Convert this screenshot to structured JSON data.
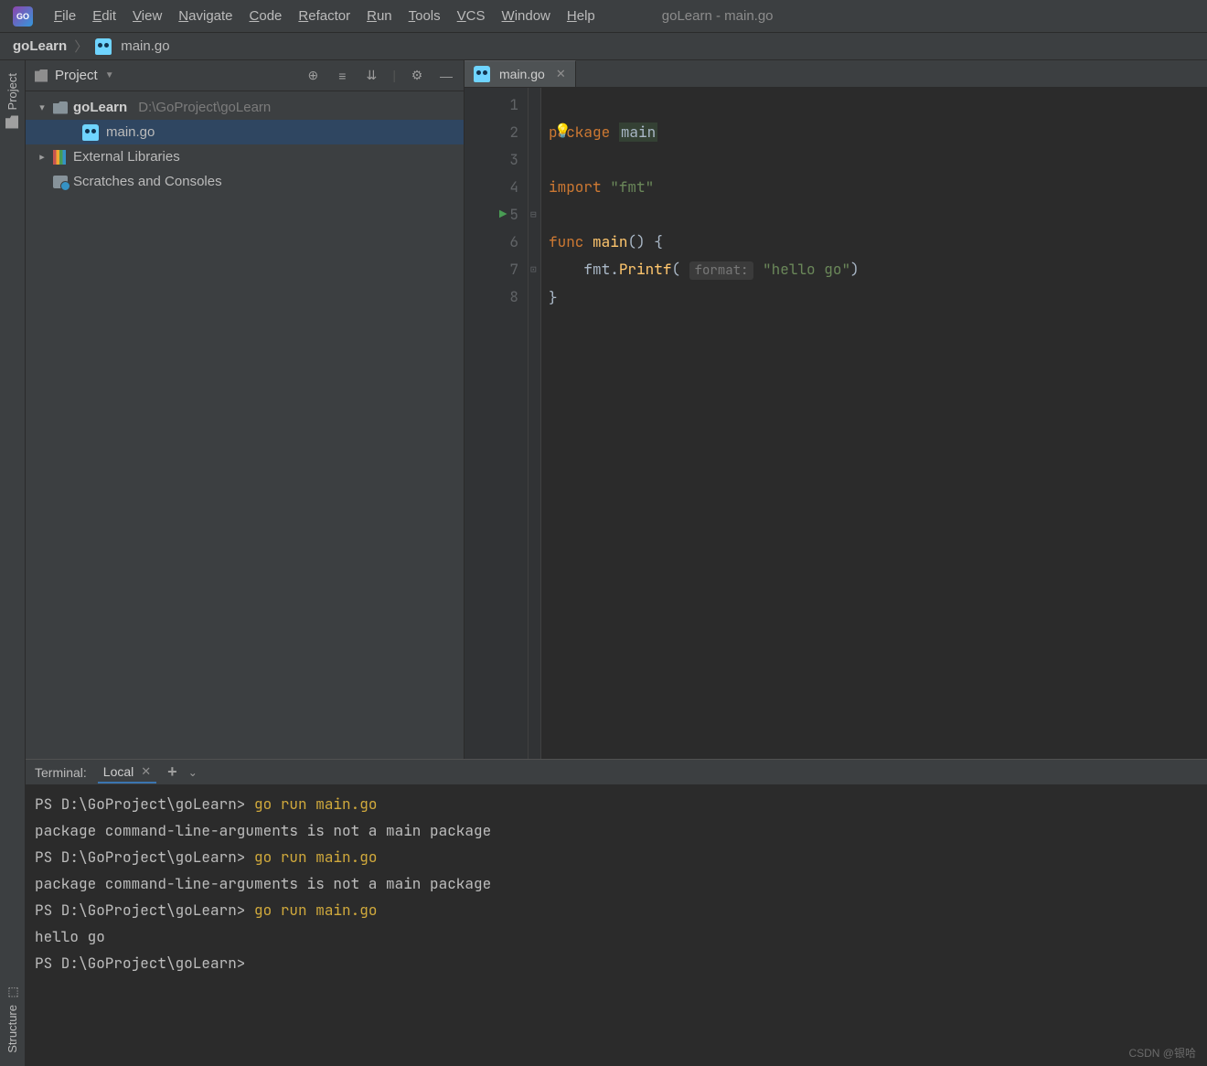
{
  "window_title": "goLearn - main.go",
  "menu": [
    "File",
    "Edit",
    "View",
    "Navigate",
    "Code",
    "Refactor",
    "Run",
    "Tools",
    "VCS",
    "Window",
    "Help"
  ],
  "breadcrumb": {
    "project": "goLearn",
    "file": "main.go"
  },
  "left_tabs": {
    "top": "Project",
    "bottom": "Structure"
  },
  "project_panel": {
    "title": "Project",
    "root": "goLearn",
    "root_path": "D:\\GoProject\\goLearn",
    "file": "main.go",
    "external": "External Libraries",
    "scratches": "Scratches and Consoles"
  },
  "editor": {
    "tab": "main.go",
    "lines": [
      "1",
      "2",
      "3",
      "4",
      "5",
      "6",
      "7",
      "8"
    ],
    "run_line": 5,
    "code": {
      "l1a": "package ",
      "l1b": "main",
      "l3a": "import ",
      "l3b": "\"fmt\"",
      "l5a": "func ",
      "l5b": "main",
      "l5c": "() {",
      "l6a": "    fmt.",
      "l6b": "Printf",
      "l6c": "( ",
      "l6hint": "format:",
      "l6d": " \"hello go\"",
      "l6e": ")",
      "l7": "}"
    }
  },
  "terminal": {
    "header": "Terminal:",
    "tab": "Local",
    "lines": [
      {
        "t": "prompt",
        "p": "PS D:\\GoProject\\goLearn> ",
        "c": "go run main.go"
      },
      {
        "t": "out",
        "v": "package command-line-arguments is not a main package"
      },
      {
        "t": "prompt",
        "p": "PS D:\\GoProject\\goLearn> ",
        "c": "go run main.go"
      },
      {
        "t": "out",
        "v": "package command-line-arguments is not a main package"
      },
      {
        "t": "prompt",
        "p": "PS D:\\GoProject\\goLearn> ",
        "c": "go run main.go"
      },
      {
        "t": "out",
        "v": "hello go"
      },
      {
        "t": "prompt",
        "p": "PS D:\\GoProject\\goLearn> ",
        "c": ""
      }
    ]
  },
  "watermark": "CSDN @银哈"
}
